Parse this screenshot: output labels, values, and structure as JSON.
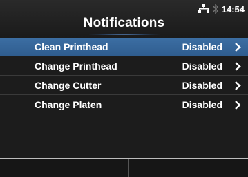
{
  "header": {
    "title": "Notifications",
    "time": "14:54",
    "icons": [
      "network-icon",
      "bluetooth-icon"
    ]
  },
  "list": {
    "items": [
      {
        "label": "Clean Printhead",
        "value": "Disabled",
        "selected": true
      },
      {
        "label": "Change Printhead",
        "value": "Disabled",
        "selected": false
      },
      {
        "label": "Change Cutter",
        "value": "Disabled",
        "selected": false
      },
      {
        "label": "Change Platen",
        "value": "Disabled",
        "selected": false
      }
    ]
  },
  "softkeys": {
    "left": "",
    "right": ""
  },
  "colors": {
    "selected_row": "#3a6a9e",
    "background": "#1c1c1c",
    "text": "#ffffff"
  }
}
